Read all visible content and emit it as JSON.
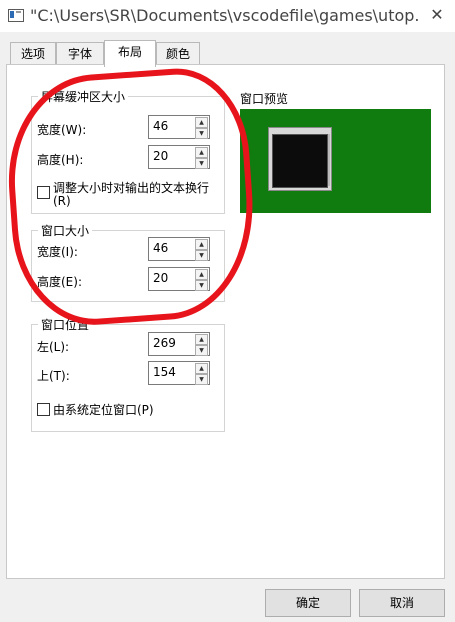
{
  "window": {
    "title": "\"C:\\Users\\SR\\Documents\\vscodefile\\games\\utop...",
    "close_glyph": "✕"
  },
  "tabs": [
    {
      "label": "选项",
      "active": false
    },
    {
      "label": "字体",
      "active": false
    },
    {
      "label": "布局",
      "active": true
    },
    {
      "label": "颜色",
      "active": false
    }
  ],
  "buffer_size": {
    "legend": "屏幕缓冲区大小",
    "width_label": "宽度(W):",
    "width_value": "46",
    "height_label": "高度(H):",
    "height_value": "20",
    "wrap_label": "调整大小时对输出的文本换行",
    "wrap_label_2": "(R)",
    "wrap_checked": false
  },
  "window_size": {
    "legend": "窗口大小",
    "width_label": "宽度(I):",
    "width_value": "46",
    "height_label": "高度(E):",
    "height_value": "20"
  },
  "window_position": {
    "legend": "窗口位置",
    "left_label": "左(L):",
    "left_value": "269",
    "top_label": "上(T):",
    "top_value": "154",
    "system_label": "由系统定位窗口(P)",
    "system_checked": false
  },
  "preview": {
    "label": "窗口预览",
    "background_color": "#107c10"
  },
  "buttons": {
    "ok": "确定",
    "cancel": "取消"
  },
  "spin_glyphs": {
    "up": "▲",
    "down": "▼"
  },
  "annotation_color": "#e8141b"
}
